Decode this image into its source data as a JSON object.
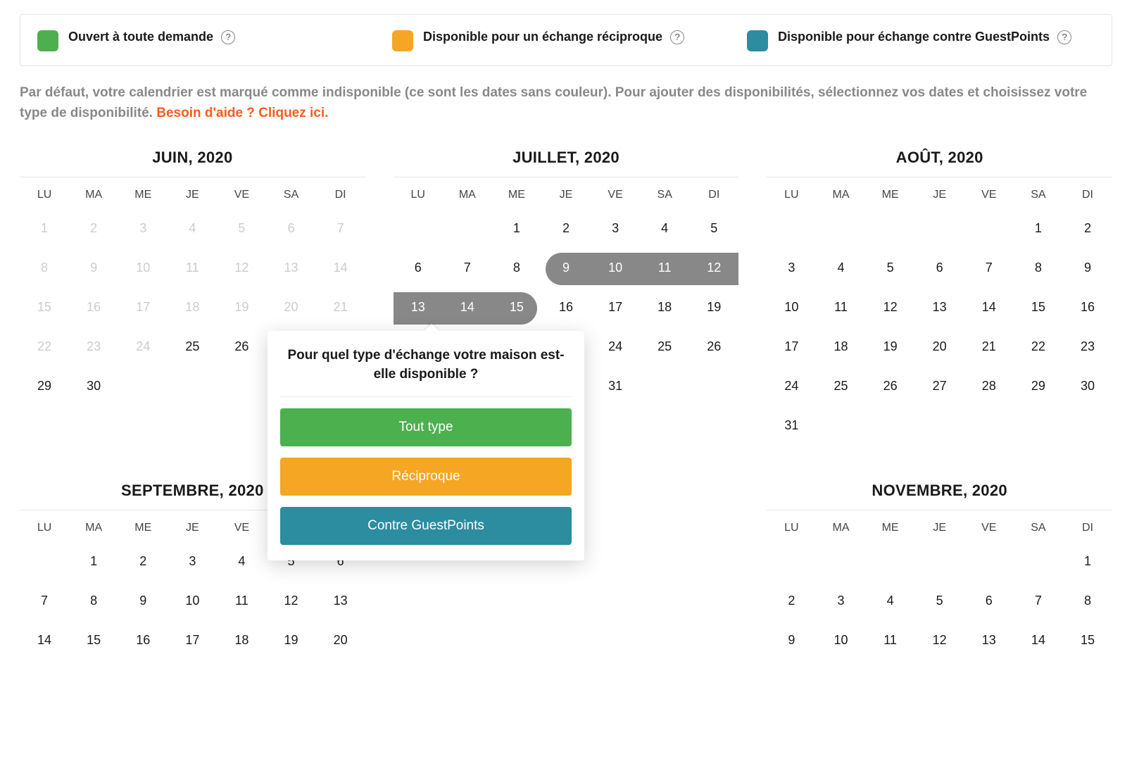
{
  "legend": {
    "any": "Ouvert à toute demande",
    "reciprocal": "Disponible pour un échange réciproque",
    "guestpoints": "Disponible pour échange contre GuestPoints"
  },
  "instructions": {
    "text": "Par défaut, votre calendrier est marqué comme indisponible (ce sont les dates sans couleur). Pour ajouter des disponibilités, sélectionnez vos dates et choisissez votre type de disponibilité.",
    "help_link": "Besoin d'aide ? Cliquez ici."
  },
  "dow": [
    "LU",
    "MA",
    "ME",
    "JE",
    "VE",
    "SA",
    "DI"
  ],
  "months": {
    "jun": {
      "title": "JUIN, 2020",
      "startDow": 0,
      "days": 30,
      "disabledThrough": 24
    },
    "jul": {
      "title": "JUILLET, 2020",
      "startDow": 2,
      "days": 31,
      "selected": [
        9,
        10,
        11,
        12,
        13,
        14,
        15
      ]
    },
    "aug": {
      "title": "AOÛT, 2020",
      "startDow": 5,
      "days": 31
    },
    "sep": {
      "title": "SEPTEMBRE, 2020",
      "startDow": 1,
      "days": 30,
      "visibleRows": 3
    },
    "nov": {
      "title": "NOVEMBRE, 2020",
      "startDow": 6,
      "days": 30,
      "visibleRows": 3
    }
  },
  "popover": {
    "title": "Pour quel type d'échange votre maison est-elle disponible ?",
    "btn_all": "Tout type",
    "btn_reciprocal": "Réciproque",
    "btn_gp": "Contre GuestPoints"
  }
}
